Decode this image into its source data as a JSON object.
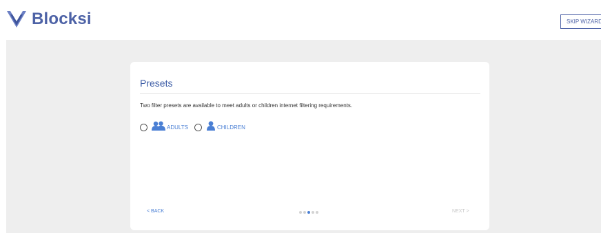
{
  "header": {
    "brand_name": "Blocksi",
    "skip_label": "SKIP WIZARD",
    "logo_icon": "blocksi-logo-icon",
    "brand_color": "#4d62a6"
  },
  "wizard": {
    "title": "Presets",
    "description": "Two filter presets are available to meet adults or children internet filtering requirements.",
    "options": [
      {
        "label": "ADULTS",
        "icon": "adults-icon",
        "selected": false
      },
      {
        "label": "CHILDREN",
        "icon": "child-icon",
        "selected": false
      }
    ],
    "back_label": "< BACK",
    "next_label": "NEXT >",
    "steps_total": 5,
    "current_step": 3,
    "accent_color": "#4a7fd4"
  }
}
